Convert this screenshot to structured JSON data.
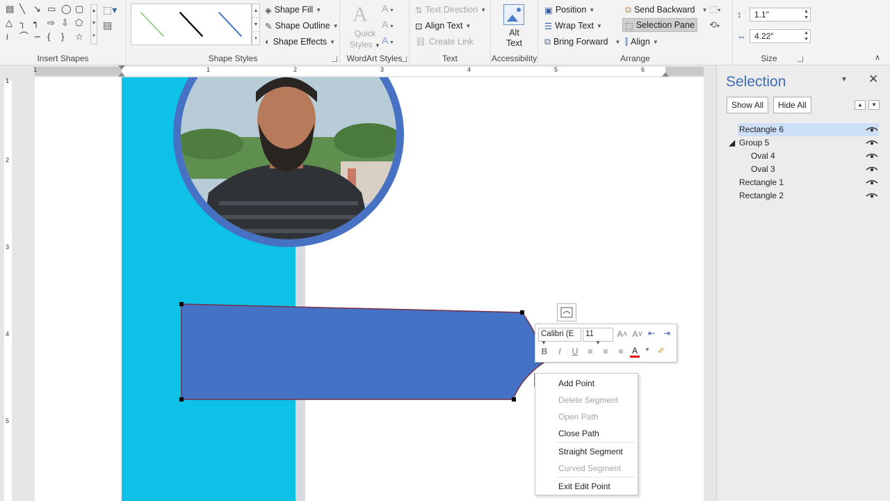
{
  "ribbon": {
    "groups": {
      "insert_shapes": "Insert Shapes",
      "shape_styles": "Shape Styles",
      "wordart_styles": "WordArt Styles",
      "text": "Text",
      "accessibility": "Accessibility",
      "arrange": "Arrange",
      "size": "Size"
    },
    "shape_fill": "Shape Fill",
    "shape_outline": "Shape Outline",
    "shape_effects": "Shape Effects",
    "quick_styles_1": "Quick",
    "quick_styles_2": "Styles",
    "text_direction": "Text Direction",
    "align_text": "Align Text",
    "create_link": "Create Link",
    "alt_text_1": "Alt",
    "alt_text_2": "Text",
    "position": "Position",
    "wrap_text": "Wrap Text",
    "bring_forward": "Bring Forward",
    "send_backward": "Send Backward",
    "selection_pane": "Selection Pane",
    "align": "Align",
    "height": "1.1\"",
    "width": "4.22\""
  },
  "ruler": {
    "h_numbers": [
      "1",
      "1",
      "2",
      "3",
      "4",
      "5",
      "6"
    ],
    "v_numbers": [
      "1",
      "2",
      "3",
      "4",
      "5"
    ]
  },
  "mini_toolbar": {
    "font": "Calibri (E",
    "size": "11"
  },
  "context_menu": {
    "items": [
      {
        "label": "Add Point",
        "enabled": true
      },
      {
        "label": "Delete Segment",
        "enabled": false
      },
      {
        "label": "Open Path",
        "enabled": false
      },
      {
        "label": "Close Path",
        "enabled": true
      },
      {
        "label": "Straight Segment",
        "enabled": true
      },
      {
        "label": "Curved Segment",
        "enabled": false
      },
      {
        "label": "Exit Edit Point",
        "enabled": true
      }
    ]
  },
  "selection_pane": {
    "title": "Selection",
    "show_all": "Show All",
    "hide_all": "Hide All",
    "items": [
      {
        "label": "Rectangle 6",
        "selected": true
      },
      {
        "label": "Group 5",
        "selected": false
      },
      {
        "label": "Oval 4",
        "selected": false
      },
      {
        "label": "Oval 3",
        "selected": false
      },
      {
        "label": "Rectangle 1",
        "selected": false
      },
      {
        "label": "Rectangle 2",
        "selected": false
      }
    ]
  },
  "colors": {
    "accent": "#3d6eb3",
    "shape_fill": "#4472c4",
    "sidebar_cyan": "#0ec1e6"
  }
}
